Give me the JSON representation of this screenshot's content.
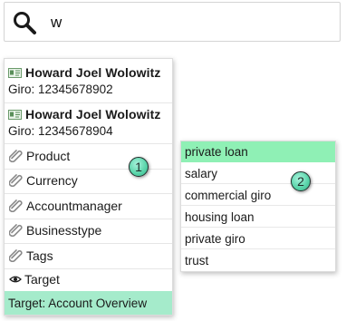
{
  "search": {
    "query": "w",
    "icon": "magnifier-icon"
  },
  "contacts": [
    {
      "icon": "contact-card-icon",
      "name": "Howard Joel Wolowitz",
      "giro": "Giro: 12345678902"
    },
    {
      "icon": "contact-card-icon",
      "name": "Howard Joel Wolowitz",
      "giro": "Giro: 12345678904"
    }
  ],
  "categories": [
    {
      "icon": "paperclip-icon",
      "label": "Product"
    },
    {
      "icon": "paperclip-icon",
      "label": "Currency"
    },
    {
      "icon": "paperclip-icon",
      "label": "Accountmanager"
    },
    {
      "icon": "paperclip-icon",
      "label": "Businesstype"
    },
    {
      "icon": "paperclip-icon",
      "label": "Tags"
    },
    {
      "icon": "target-icon",
      "label": "Target"
    }
  ],
  "footer": {
    "label": "Target: Account Overview",
    "color": "#a5ebcb"
  },
  "submenu": {
    "options": [
      "private loan",
      "salary",
      "commercial giro",
      "housing loan",
      "private giro",
      "trust"
    ],
    "selected": "private loan",
    "selected_color": "#8ff0b5"
  },
  "badges": [
    "1",
    "2"
  ]
}
